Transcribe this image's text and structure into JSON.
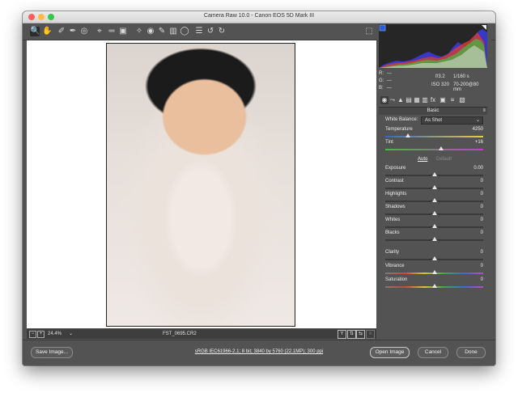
{
  "window": {
    "title": "Camera Raw 10.0  -  Canon EOS 5D Mark III"
  },
  "toolbar": {
    "icons": [
      "zoom-icon",
      "hand-icon",
      "white-balance-icon",
      "color-sampler-icon",
      "target-adjust-icon",
      "crop-icon",
      "straighten-icon",
      "transform-icon",
      "spot-removal-icon",
      "red-eye-icon",
      "adjustment-brush-icon",
      "graduated-filter-icon",
      "radial-filter-icon",
      "preferences-icon",
      "rotate-left-icon",
      "rotate-right-icon"
    ],
    "fullscreen_icon": "fullscreen-icon"
  },
  "status": {
    "zoom": "24.4%",
    "filename": "FST_0695.CR2"
  },
  "info": {
    "r": "R:",
    "r_val": "---",
    "g": "G:",
    "g_val": "---",
    "b": "B:",
    "b_val": "---",
    "aperture": "f/3.2",
    "shutter": "1/160 s",
    "iso": "ISO 320",
    "lens": "70-200@80 mm"
  },
  "panel": {
    "section": "Basic"
  },
  "basic": {
    "wb_label": "White Balance:",
    "wb_value": "As Shot",
    "temperature_label": "Temperature",
    "temperature_value": "4250",
    "tint_label": "Tint",
    "tint_value": "+16",
    "auto": "Auto",
    "default": "Default",
    "exposure_label": "Exposure",
    "exposure_value": "0.00",
    "contrast_label": "Contrast",
    "contrast_value": "0",
    "highlights_label": "Highlights",
    "highlights_value": "0",
    "shadows_label": "Shadows",
    "shadows_value": "0",
    "whites_label": "Whites",
    "whites_value": "0",
    "blacks_label": "Blacks",
    "blacks_value": "0",
    "clarity_label": "Clarity",
    "clarity_value": "0",
    "vibrance_label": "Vibrance",
    "vibrance_value": "0",
    "saturation_label": "Saturation",
    "saturation_value": "0"
  },
  "bottom": {
    "save": "Save Image...",
    "workflow": "sRGB IEC61966-2.1; 8 bit; 3840 by 5760 (22.1MP); 300 ppi",
    "open": "Open Image",
    "cancel": "Cancel",
    "done": "Done"
  },
  "colors": {
    "accent": "#2a5bd7",
    "panel_bg": "#535353",
    "canvas_bg": "#ffffff"
  }
}
